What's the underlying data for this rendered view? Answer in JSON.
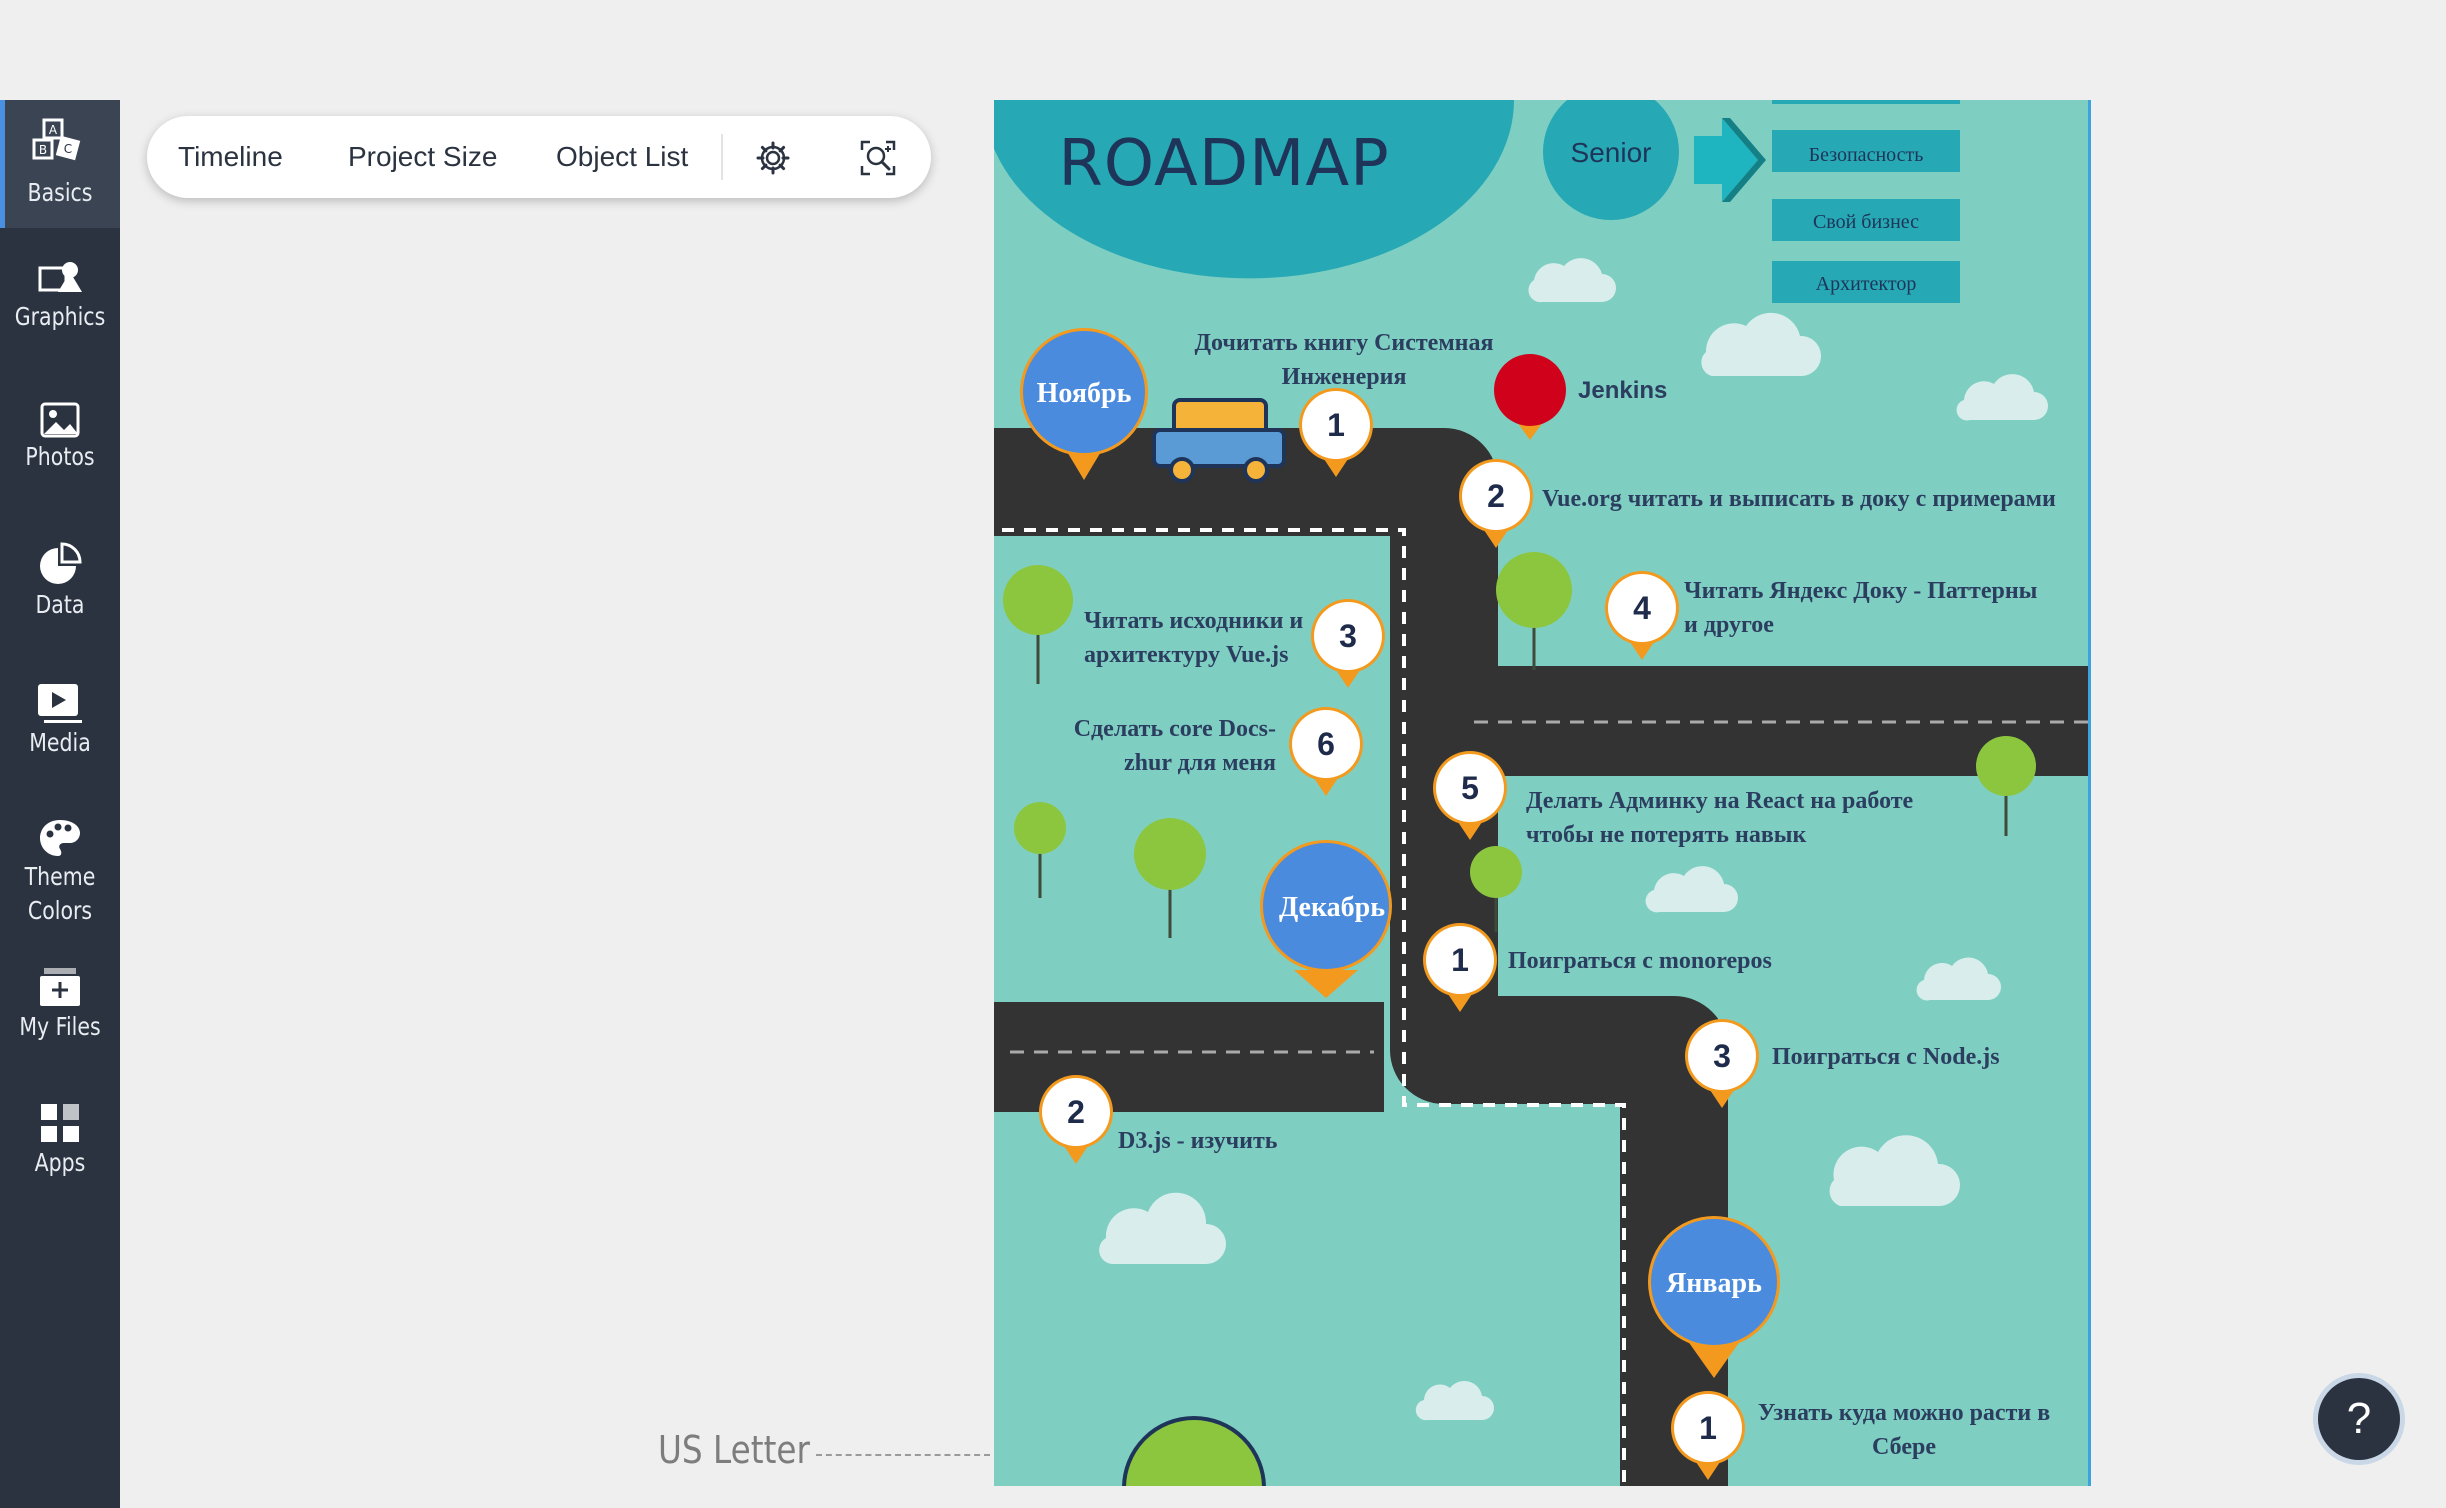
{
  "sidebar": {
    "items": [
      {
        "label": "Basics",
        "icon": "abc-blocks-icon",
        "active": true
      },
      {
        "label": "Graphics",
        "icon": "shapes-icon"
      },
      {
        "label": "Photos",
        "icon": "photo-icon"
      },
      {
        "label": "Data",
        "icon": "pie-chart-icon"
      },
      {
        "label": "Media",
        "icon": "media-play-icon"
      },
      {
        "label": "Theme\nColors",
        "label1": "Theme",
        "label2": "Colors",
        "icon": "palette-icon"
      },
      {
        "label": "My Files",
        "icon": "upload-folder-icon"
      },
      {
        "label": "Apps",
        "icon": "apps-grid-icon"
      }
    ]
  },
  "toolbar": {
    "timeline": "Timeline",
    "project_size": "Project Size",
    "object_list": "Object List"
  },
  "canvas": {
    "page_size_label": "US Letter",
    "roadmap": {
      "title": "ROADMAP",
      "senior": "Senior",
      "boxes": [
        "Безопасность",
        "Свой бизнес",
        "Архитектор"
      ],
      "months": [
        "Ноябрь",
        "Декабрь",
        "Январь"
      ],
      "jenkins": "Jenkins",
      "items": [
        {
          "num": "1",
          "text": "Дочитать книгу Системная Инженерия"
        },
        {
          "num": "2",
          "text": "Vue.org читать и выписать в доку с примерами"
        },
        {
          "num": "3",
          "text": "Читать исходники и архитектуру Vue.js"
        },
        {
          "num": "4",
          "text": "Читать Яндекс Доку - Паттерны и другое"
        },
        {
          "num": "6",
          "text": "Сделать core Docs-zhur для меня"
        },
        {
          "num": "5",
          "text": "Делать Админку на React на работе чтобы не потерять навык"
        },
        {
          "num": "1",
          "text": "Поиграться с monorepos"
        },
        {
          "num": "3",
          "text": "Поиграться с Node.js"
        },
        {
          "num": "2",
          "text": "D3.js - изучить"
        },
        {
          "num": "1",
          "text": "Узнать куда можно расти в Сбере"
        }
      ]
    }
  },
  "help": {
    "label": "?"
  },
  "colors": {
    "sidebar": "#2b3340",
    "canvas_bg": "#7ecfc2",
    "road": "#333333",
    "pin": "#f39a1e",
    "month": "#4a8bde",
    "teal": "#26a8b5"
  }
}
